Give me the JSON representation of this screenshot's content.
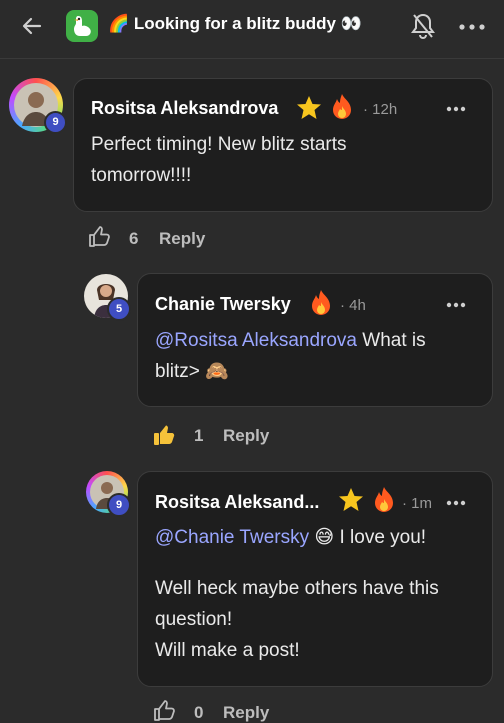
{
  "header": {
    "title": "🌈 Looking for a blitz buddy 👀"
  },
  "comments": [
    {
      "author": "Rositsa Aleksandrova",
      "time": "12h",
      "badge": "9",
      "text": "Perfect timing! New blitz starts tomorrow!!!!",
      "likes": "6",
      "reply_label": "Reply"
    },
    {
      "author": "Chanie Twersky",
      "time": "4h",
      "badge": "5",
      "mention": "@Rositsa Aleksandrova",
      "text_after_mention": " What is blitz> 🙈",
      "likes": "1",
      "reply_label": "Reply"
    },
    {
      "author": "Rositsa Aleksand...",
      "time": "1m",
      "badge": "9",
      "mention": "@Chanie Twersky",
      "text_after_mention": " 😅 I love you!",
      "line2": "Well heck maybe others have this question!",
      "line3": "Will make a post!",
      "likes": "0",
      "reply_label": "Reply"
    }
  ],
  "colors": {
    "background": "#2b2b2b",
    "bubble": "#1e1e1e",
    "mention": "#9aa6ff",
    "badge": "#3f4ec2"
  }
}
